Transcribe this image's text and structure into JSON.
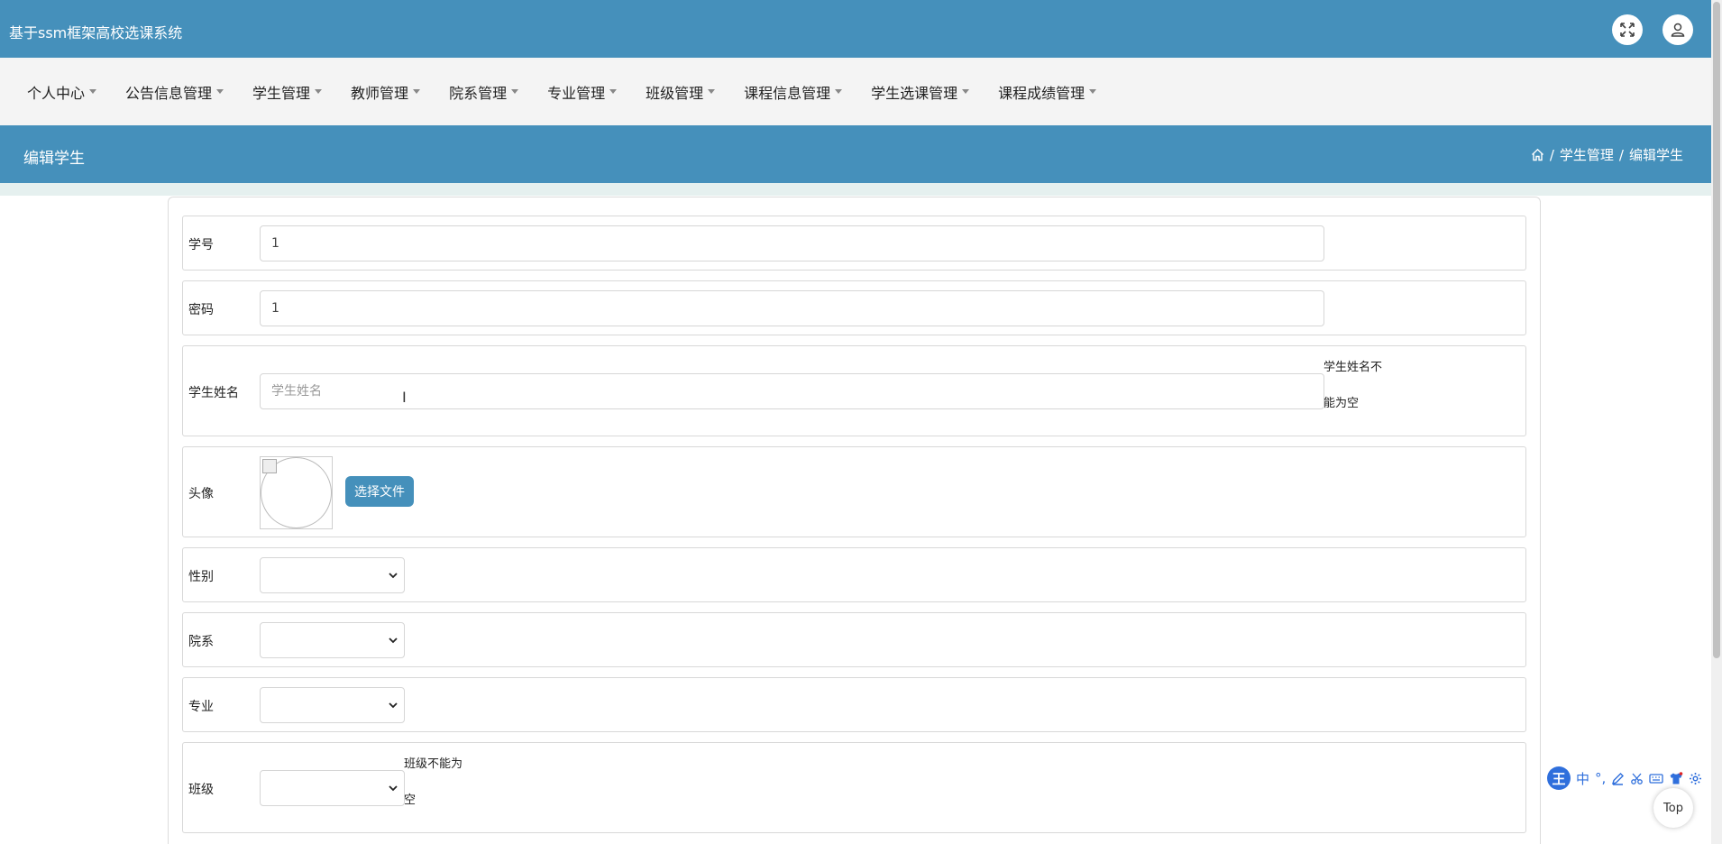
{
  "app": {
    "title": "基于ssm框架高校选课系统"
  },
  "header": {
    "fullscreen_icon": "expand-arrows-icon",
    "user_icon": "user-icon"
  },
  "nav": [
    {
      "label": "个人中心"
    },
    {
      "label": "公告信息管理"
    },
    {
      "label": "学生管理"
    },
    {
      "label": "教师管理"
    },
    {
      "label": "院系管理"
    },
    {
      "label": "专业管理"
    },
    {
      "label": "班级管理"
    },
    {
      "label": "课程信息管理"
    },
    {
      "label": "学生选课管理"
    },
    {
      "label": "课程成绩管理"
    }
  ],
  "page": {
    "title": "编辑学生",
    "breadcrumb": {
      "home_icon": "home-icon",
      "section": "学生管理",
      "current": "编辑学生",
      "separator": "/"
    }
  },
  "form": {
    "student_id": {
      "label": "学号",
      "value": "1"
    },
    "password": {
      "label": "密码",
      "value": "1"
    },
    "student_name": {
      "label": "学生姓名",
      "value": "",
      "placeholder": "学生姓名",
      "error_line1": "学生姓名不",
      "error_line2": "能为空"
    },
    "avatar": {
      "label": "头像",
      "button_label": "选择文件"
    },
    "gender": {
      "label": "性别",
      "selected": ""
    },
    "department": {
      "label": "院系",
      "selected": ""
    },
    "major": {
      "label": "专业",
      "selected": ""
    },
    "class": {
      "label": "班级",
      "selected": "",
      "error_line1": "班级不能为",
      "error_line2": "空"
    }
  },
  "ime_toolbar": {
    "logo": "王",
    "mode": "中",
    "punct": "°,",
    "items": [
      "pen-icon",
      "scissors-icon",
      "keyboard-icon",
      "shirt-icon",
      "gear-icon"
    ]
  },
  "back_to_top": {
    "label": "Top"
  },
  "colors": {
    "primary": "#4590bb",
    "nav_bg": "#f4f4f4",
    "strip": "#e5f0ef",
    "ime_blue": "#2f6fdc"
  }
}
